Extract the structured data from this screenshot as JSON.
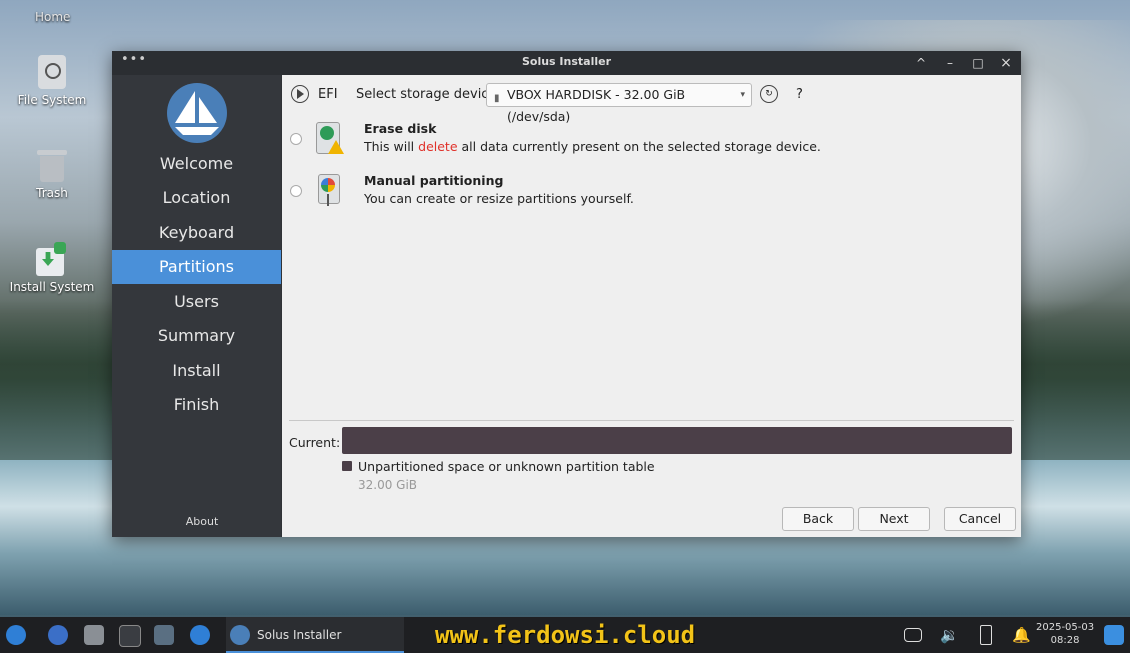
{
  "desktop": {
    "home_label": "Home",
    "icons": [
      {
        "label": "File System",
        "icon": "drive-icon"
      },
      {
        "label": "Trash",
        "icon": "trash-icon"
      },
      {
        "label": "Install System",
        "icon": "install-icon"
      }
    ]
  },
  "window": {
    "title": "Solus Installer",
    "controls": [
      "^",
      "–",
      "□",
      "×"
    ]
  },
  "sidebar": {
    "items": [
      {
        "label": "Welcome"
      },
      {
        "label": "Location"
      },
      {
        "label": "Keyboard"
      },
      {
        "label": "Partitions",
        "active": true
      },
      {
        "label": "Users"
      },
      {
        "label": "Summary"
      },
      {
        "label": "Install"
      },
      {
        "label": "Finish"
      }
    ],
    "about_label": "About"
  },
  "partitions": {
    "efi_label": "EFI",
    "storage_label": "Select storage device:",
    "storage_value": "VBOX HARDDISK - 32.00 GiB (/dev/sda)",
    "help_label": "?",
    "options": [
      {
        "title": "Erase disk",
        "desc_before": "This will ",
        "desc_emphasis": "delete",
        "desc_after": " all data currently present on the selected storage device."
      },
      {
        "title": "Manual partitioning",
        "desc": "You can create or resize partitions yourself."
      }
    ],
    "current_label": "Current:",
    "legend_label": "Unpartitioned space or unknown partition table",
    "legend_size": "32.00 GiB"
  },
  "buttons": {
    "back": "Back",
    "next": "Next",
    "cancel": "Cancel"
  },
  "taskbar": {
    "task_label": "Solus Installer",
    "watermark": "www.ferdowsi.cloud",
    "date": "2025-05-03",
    "time": "08:28"
  },
  "colors": {
    "accent": "#4a90d9",
    "delete_red": "#e0312a",
    "partition_bar": "#4b3f48",
    "watermark": "#f2c318"
  }
}
